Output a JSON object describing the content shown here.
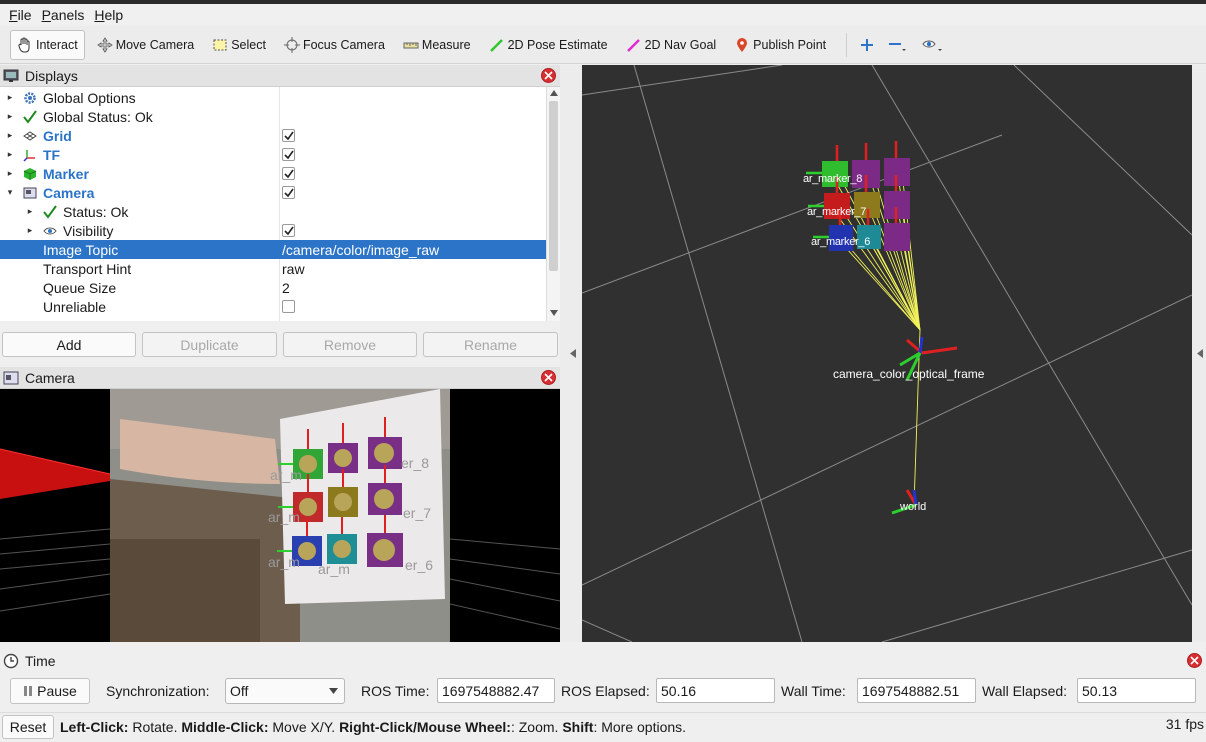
{
  "menu": [
    "File",
    "Panels",
    "Help"
  ],
  "toolbar": {
    "tools": [
      {
        "label": "Interact",
        "icon": "hand-icon"
      },
      {
        "label": "Move Camera",
        "icon": "move-camera-icon"
      },
      {
        "label": "Select",
        "icon": "select-icon"
      },
      {
        "label": "Focus Camera",
        "icon": "focus-camera-icon"
      },
      {
        "label": "Measure",
        "icon": "measure-icon"
      },
      {
        "label": "2D Pose Estimate",
        "icon": "pose-estimate-icon"
      },
      {
        "label": "2D Nav Goal",
        "icon": "nav-goal-icon"
      },
      {
        "label": "Publish Point",
        "icon": "publish-point-icon"
      }
    ]
  },
  "displays": {
    "title": "Displays",
    "rows": [
      {
        "label": "Global Options",
        "value": ""
      },
      {
        "label": "Global Status: Ok",
        "value": ""
      },
      {
        "label": "Grid",
        "value": ""
      },
      {
        "label": "TF",
        "value": ""
      },
      {
        "label": "Marker",
        "value": ""
      },
      {
        "label": "Camera",
        "value": ""
      },
      {
        "label": "Status: Ok",
        "value": ""
      },
      {
        "label": "Visibility",
        "value": ""
      },
      {
        "label": "Image Topic",
        "value": "/camera/color/image_raw"
      },
      {
        "label": "Transport Hint",
        "value": "raw"
      },
      {
        "label": "Queue Size",
        "value": "2"
      },
      {
        "label": "Unreliable",
        "value": ""
      }
    ],
    "buttons": {
      "add": "Add",
      "duplicate": "Duplicate",
      "remove": "Remove",
      "rename": "Rename"
    }
  },
  "camera_panel": {
    "title": "Camera",
    "overlay_labels": [
      "ar_m",
      "ar_m",
      "ar_m",
      "ar_m",
      "er_8",
      "er_7",
      "er_6"
    ]
  },
  "viewport": {
    "labels": {
      "marker_8": "ar_marker_8",
      "marker_7": "ar_marker_7",
      "marker_6": "ar_marker_6",
      "camera_frames": "camera_color_optical_frame",
      "world": "world"
    }
  },
  "time": {
    "title": "Time",
    "pause_label": "Pause",
    "sync_label": "Synchronization:",
    "sync_value": "Off",
    "ros_time_label": "ROS Time:",
    "ros_time": "1697548882.47",
    "ros_elapsed_label": "ROS Elapsed:",
    "ros_elapsed": "50.16",
    "wall_time_label": "Wall Time:",
    "wall_time": "1697548882.51",
    "wall_elapsed_label": "Wall Elapsed:",
    "wall_elapsed": "50.13"
  },
  "status": {
    "reset_label": "Reset",
    "left_click": "Left-Click:",
    "left_click_desc": " Rotate. ",
    "middle_click": "Middle-Click:",
    "middle_click_desc": " Move X/Y. ",
    "right_click": "Right-Click/Mouse Wheel:",
    "right_click_desc": ": Zoom. ",
    "shift": "Shift",
    "shift_desc": ": More options.",
    "fps": "31 fps"
  }
}
